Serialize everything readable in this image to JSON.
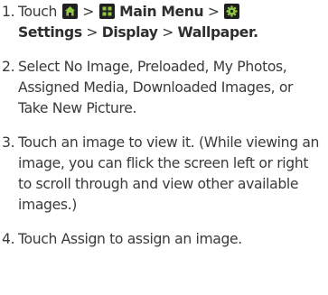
{
  "steps": [
    {
      "number": "1.",
      "text": {
        "touch": "Touch",
        "sep1": ">",
        "main_menu": "Main Menu",
        "sep2": ">",
        "settings": "Settings",
        "sep3": ">",
        "display": "Display",
        "sep4": ">",
        "wallpaper": "Wallpaper."
      },
      "icons": [
        "home-icon",
        "main-menu-grid-icon",
        "settings-gear-icon"
      ]
    },
    {
      "number": "2.",
      "text": "Select No Image, Preloaded, My Photos, Assigned Media, Downloaded Images, or Take New Picture."
    },
    {
      "number": "3.",
      "text": "Touch an image to view it. (While viewing an image, you can flick the screen left or right to scroll through and view other available images.)"
    },
    {
      "number": "4.",
      "text": "Touch Assign to assign an image."
    }
  ],
  "colors": {
    "text": "#3a3a3a",
    "icon_bg": "#1f1f1f",
    "icon_fg": "#8ec63f"
  }
}
